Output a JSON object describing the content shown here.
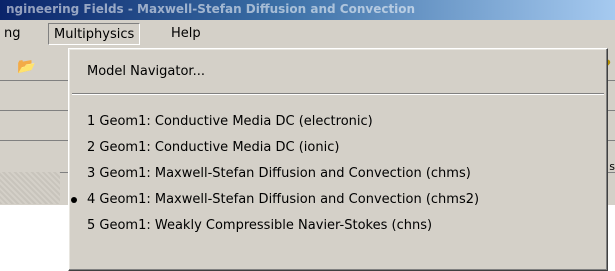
{
  "window": {
    "title_fragment": "ngineering Fields - Maxwell-Stefan Diffusion and Convection"
  },
  "menubar": {
    "items": [
      {
        "label": "ng"
      },
      {
        "label": "Multiphysics"
      },
      {
        "label": "Help"
      }
    ]
  },
  "dropdown": {
    "model_navigator": "Model Navigator...",
    "entries": [
      {
        "label": "1 Geom1: Conductive Media DC (electronic)",
        "checked": false
      },
      {
        "label": "2 Geom1: Conductive Media DC (ionic)",
        "checked": false
      },
      {
        "label": "3 Geom1: Maxwell-Stefan Diffusion and Convection (chms)",
        "checked": false
      },
      {
        "label": "4 Geom1: Maxwell-Stefan Diffusion and Convection (chms2)",
        "checked": true
      },
      {
        "label": "5 Geom1: Weakly Compressible Navier-Stokes (chns)",
        "checked": false
      }
    ]
  },
  "background": {
    "right_edge_text": "s"
  },
  "colors": {
    "menu_bg": "#d4d0c8",
    "titlebar": "#0a246a"
  }
}
